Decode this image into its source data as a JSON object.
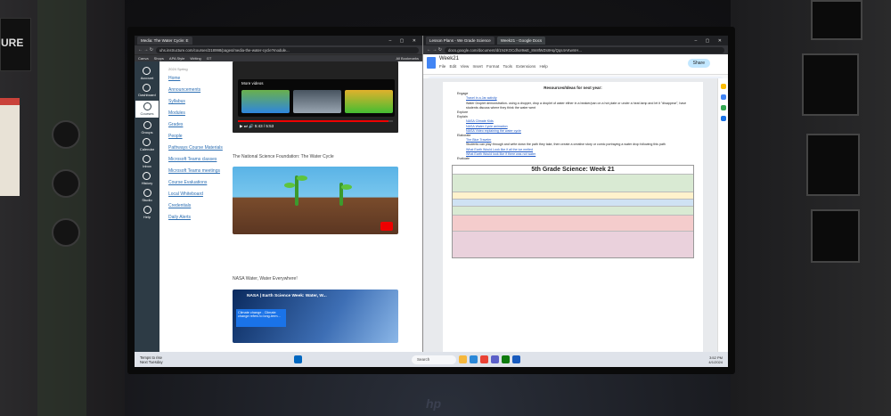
{
  "left_window": {
    "tab_title": "Media: The Water Cycle: E",
    "url": "uhs.instructure.com/courses/218998/pages/media-the-water-cycle?module...",
    "bookmarks": [
      "Canva",
      "Shops",
      "APA Style",
      "Writing",
      "GT",
      "All Bookmarks"
    ],
    "global_nav": [
      "Account",
      "Dashboard",
      "Courses",
      "Groups",
      "Calendar",
      "Inbox",
      "History",
      "Studio",
      "Help"
    ],
    "course_nav": [
      "Home",
      "Announcements",
      "Syllabus",
      "Modules",
      "Grades",
      "People",
      "Pathways Course Materials",
      "Microsoft Teams classes",
      "Microsoft Teams meetings",
      "Course Evaluations",
      "Local Whiteboard",
      "Credentials",
      "Daily Alerts"
    ],
    "course_crumb": "2024 Spring",
    "video": {
      "panel_title": "More videos",
      "time": "5:43 / 5:53",
      "progress": 0.97
    },
    "video2_title": "The National Science Foundation: The Water Cycle",
    "video3_label": "NASA Water, Water Everywhere!",
    "video3_title": "NASA | Earth Science Week: Water, W...",
    "video3_overlay": "Climate change - Climate change refers to long-term..."
  },
  "right_window": {
    "tabs": [
      "Lesson Plans - We Grade Science",
      "Week21 - Google Docs"
    ],
    "url": "docs.google.com/document/d/1NzKOCdhoI9wE_8m8lWZs8Hq/Qqs4AKwmH...",
    "doc_title": "Week21",
    "menu": [
      "File",
      "Edit",
      "View",
      "Insert",
      "Format",
      "Tools",
      "Extensions",
      "Help"
    ],
    "share_label": "Share",
    "toolbar": "100%   Normal text   Arial   –  10  +   B  I  U  A   Table options",
    "resources_heading": "Resources/Ideas for next year:",
    "bullets": [
      {
        "label": "Engage",
        "items": [
          {
            "text": "Travel in a Jar activity",
            "link": true
          },
          {
            "text": "Water Droplet demonstration- using a dropper, drop a droplet of water either in a beaker/pan on a hot plate or under a heat lamp and let it \"disappear\", have students discuss where they think the water went",
            "link": false
          }
        ]
      },
      {
        "label": "Explore",
        "items": []
      },
      {
        "label": "Explain",
        "items": [
          {
            "text": "NASA Climate Kids",
            "link": true
          },
          {
            "text": "NASA Water Cycle animation",
            "link": true
          },
          {
            "text": "NASA Video explaining the water cycle",
            "link": true
          }
        ]
      },
      {
        "label": "Elaborate",
        "items": [
          {
            "text": "The Blue Traveler",
            "link": true
          },
          {
            "text": "Students can play through and write down the path they take, then create a creative story or comic portraying a water drop following this path",
            "link": false
          },
          {
            "text": "What Earth Would Look like if all the ice melted",
            "link": true
          },
          {
            "text": "What Earth Would look like if there was not water",
            "link": true
          }
        ]
      },
      {
        "label": "Evaluate",
        "items": []
      }
    ],
    "table_title": "5th Grade Science: Week 21"
  },
  "taskbar": {
    "weather": "Temps to rise",
    "weather_sub": "Next Tuesday",
    "search": "Search",
    "time": "3:52 PM",
    "date": "4/1/2024"
  }
}
